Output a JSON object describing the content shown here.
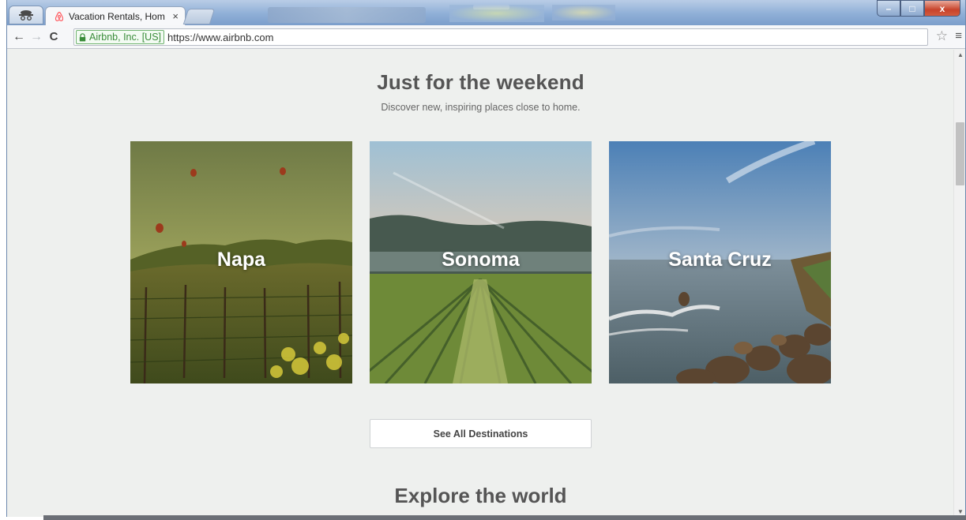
{
  "window": {
    "tab": {
      "title": "Vacation Rentals, Hom",
      "close": "×",
      "icon": "airbnb-icon"
    },
    "controls": {
      "minimize": "–",
      "maximize": "□",
      "close": "x"
    }
  },
  "toolbar": {
    "ev_label": "Airbnb, Inc. [US]",
    "url": "https://www.airbnb.com",
    "back": "←",
    "forward": "→",
    "reload": "C",
    "star": "☆",
    "menu": "≡"
  },
  "page": {
    "weekend": {
      "title": "Just for the weekend",
      "subtitle": "Discover new, inspiring places close to home."
    },
    "destinations": [
      {
        "label": "Napa"
      },
      {
        "label": "Sonoma"
      },
      {
        "label": "Santa Cruz"
      }
    ],
    "see_all": "See All Destinations",
    "explore_title": "Explore the world"
  },
  "colors": {
    "page_bg": "#eef0ee",
    "heading": "#555555",
    "brand": "#ff5a5f",
    "ev_green": "#3a8c3a"
  }
}
